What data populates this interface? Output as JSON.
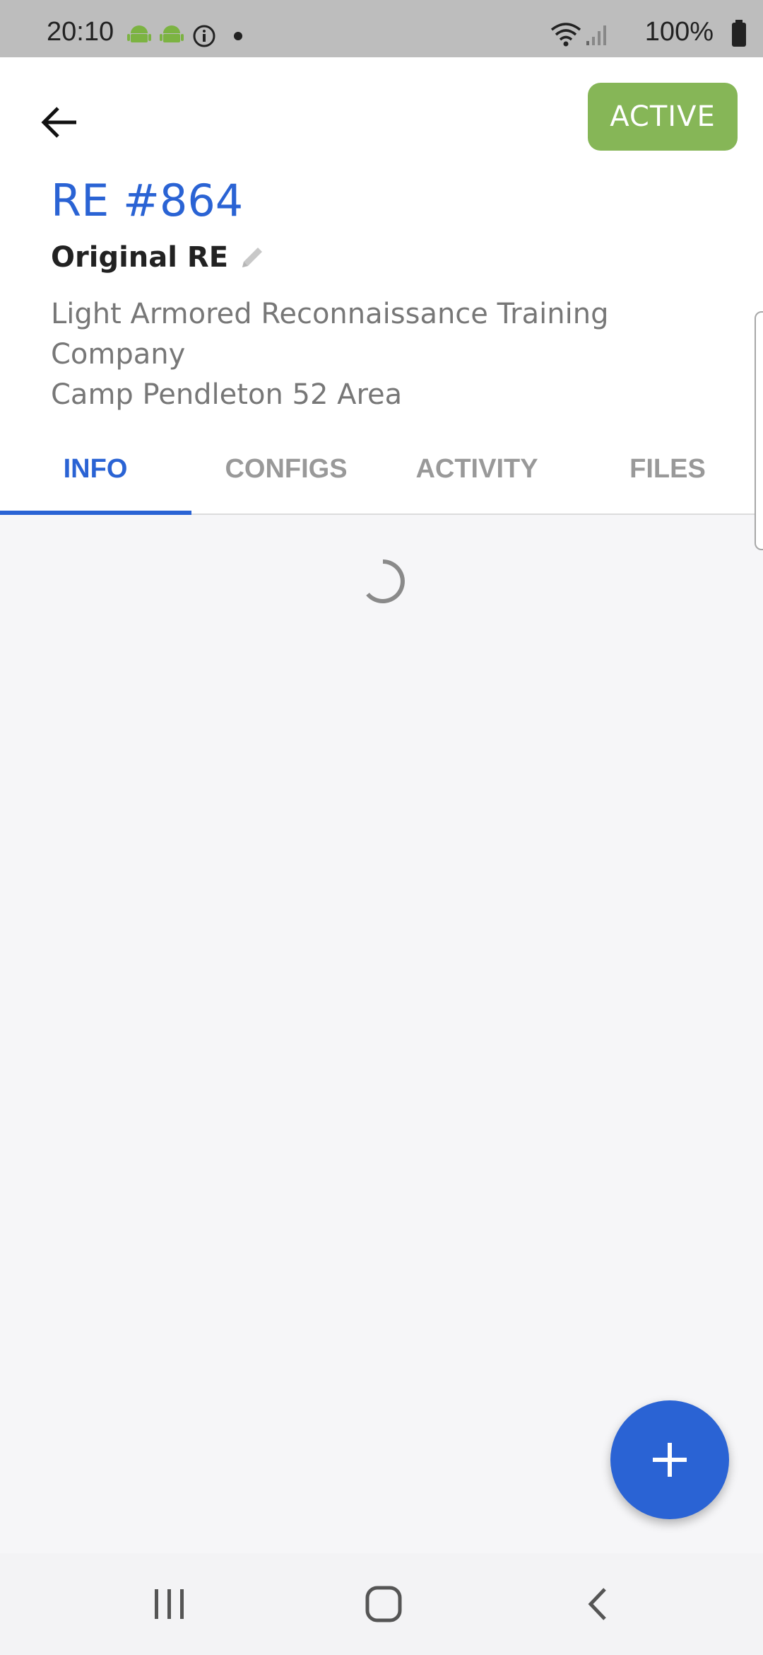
{
  "status_bar": {
    "time": "20:10",
    "battery": "100%",
    "icons": [
      "android-icon",
      "android-icon",
      "info-icon",
      "notification-dot-icon",
      "wifi-icon",
      "signal-icon",
      "battery-icon"
    ]
  },
  "header": {
    "status_badge": "ACTIVE",
    "title": "RE #864",
    "subtitle": "Original RE",
    "description_lines": [
      "Light Armored Reconnaissance Training",
      "Company",
      "Camp Pendleton 52 Area"
    ]
  },
  "tabs": [
    {
      "label": "INFO",
      "active": true
    },
    {
      "label": "CONFIGS",
      "active": false
    },
    {
      "label": "ACTIVITY",
      "active": false
    },
    {
      "label": "FILES",
      "active": false
    }
  ],
  "colors": {
    "accent": "#2a63d4",
    "badge": "#86b657",
    "background": "#f6f6f8"
  },
  "fab": {
    "icon": "plus-icon"
  },
  "nav_bar": {
    "icons": [
      "recent-apps-icon",
      "home-icon",
      "back-icon"
    ]
  }
}
